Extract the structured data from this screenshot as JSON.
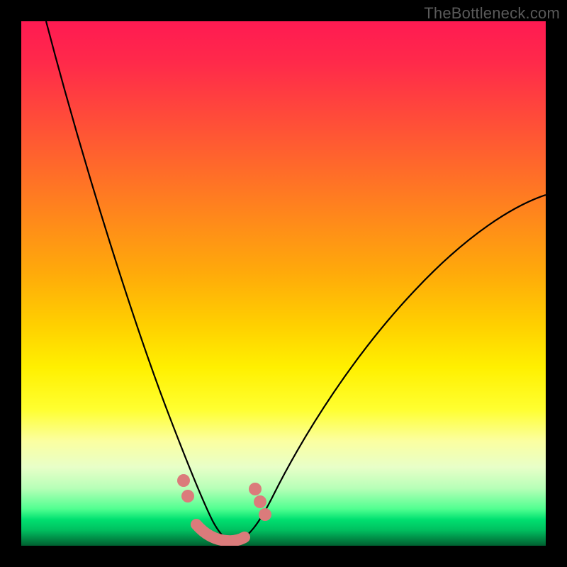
{
  "attribution": "TheBottleneck.com",
  "colors": {
    "marker": "#db7b7b",
    "curve": "#000000"
  },
  "chart_data": {
    "type": "line",
    "title": "",
    "xlabel": "",
    "ylabel": "",
    "xlim": [
      0,
      100
    ],
    "ylim": [
      0,
      100
    ],
    "grid": false,
    "legend": false,
    "series": [
      {
        "name": "left-curve",
        "x": [
          5,
          10,
          15,
          20,
          25,
          28,
          30,
          32,
          34,
          36,
          38
        ],
        "values": [
          100,
          82,
          63,
          44,
          25,
          14,
          8,
          4,
          2,
          1,
          0
        ]
      },
      {
        "name": "right-curve",
        "x": [
          42,
          45,
          50,
          55,
          60,
          70,
          80,
          90,
          100
        ],
        "values": [
          0,
          3,
          10,
          18,
          25,
          38,
          49,
          58,
          66
        ]
      }
    ],
    "markers": [
      {
        "name": "left-dot-upper",
        "x": 30,
        "y": 12
      },
      {
        "name": "left-dot-lower",
        "x": 31,
        "y": 9
      },
      {
        "name": "right-dot-a",
        "x": 44,
        "y": 11
      },
      {
        "name": "right-dot-b",
        "x": 45,
        "y": 9
      },
      {
        "name": "right-dot-c",
        "x": 46,
        "y": 6
      },
      {
        "name": "valley-segment-start",
        "x": 33,
        "y": 3
      },
      {
        "name": "valley-segment-end",
        "x": 42,
        "y": 2
      }
    ]
  }
}
